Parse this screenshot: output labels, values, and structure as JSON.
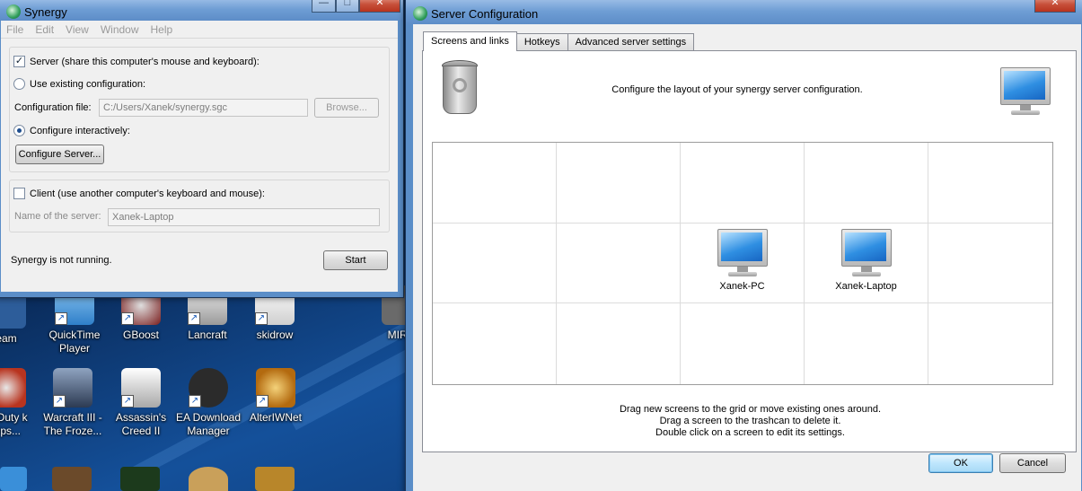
{
  "desktop": {
    "icons": [
      {
        "label": "eam",
        "color": "#3a7bd5"
      },
      {
        "label": "QuickTime Player",
        "color": "#4aa3df"
      },
      {
        "label": "GBoost",
        "color": "#9b2d2d"
      },
      {
        "label": "Lancraft",
        "color": "#c9c9c9"
      },
      {
        "label": "skidrow",
        "color": "#e0e0e0"
      },
      {
        "label": "MIRC",
        "color": "#777777"
      },
      {
        "label": "of Duty k Ops...",
        "color": "#b8341f"
      },
      {
        "label": "Warcraft III - The Froze...",
        "color": "#4f5f7a"
      },
      {
        "label": "Assassin's Creed II",
        "color": "#d9d9d9"
      },
      {
        "label": "EA Download Manager",
        "color": "#3a3a3a"
      },
      {
        "label": "AlterIWNet",
        "color": "#c98a1f"
      }
    ]
  },
  "synergy": {
    "title": "Synergy",
    "controls": {
      "minimize": "—",
      "maximize": "□",
      "close": "✕"
    },
    "menu": [
      "File",
      "Edit",
      "View",
      "Window",
      "Help"
    ],
    "server_checkbox": {
      "label": "Server (share this computer's mouse and keyboard):",
      "checked": "✓"
    },
    "use_existing": {
      "label": "Use existing configuration:"
    },
    "config_file": {
      "label": "Configuration file:",
      "value": "C:/Users/Xanek/synergy.sgc",
      "browse": "Browse..."
    },
    "configure_interactively": {
      "label": "Configure interactively:"
    },
    "configure_server_button": "Configure Server...",
    "client_checkbox": {
      "label": "Client (use another computer's keyboard and mouse):"
    },
    "server_name": {
      "label": "Name of the server:",
      "value": "Xanek-Laptop"
    },
    "status": "Synergy is not running.",
    "start_button": "Start"
  },
  "server_config": {
    "title": "Server Configuration",
    "controls": {
      "close": "✕"
    },
    "tabs": [
      "Screens and links",
      "Hotkeys",
      "Advanced server settings"
    ],
    "intro": "Configure the layout of your synergy server configuration.",
    "screens": {
      "a": "Xanek-PC",
      "b": "Xanek-Laptop"
    },
    "hints": [
      "Drag new screens to the grid or move existing ones around.",
      "Drag a screen to the trashcan to delete it.",
      "Double click on a screen to edit its settings."
    ],
    "ok": "OK",
    "cancel": "Cancel"
  }
}
